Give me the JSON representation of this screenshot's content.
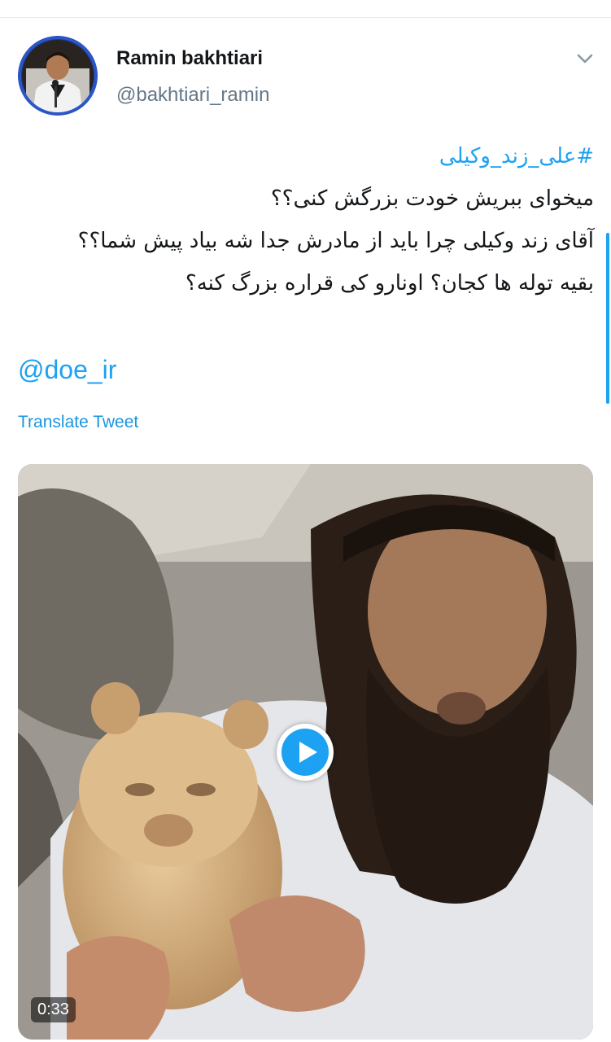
{
  "author": {
    "display_name": "Ramin bakhtiari",
    "username": "@bakhtiari_ramin",
    "avatar_icon": "user-avatar-photo"
  },
  "tweet": {
    "hashtag": "#علی_زند_وکیلی",
    "lines": [
      "میخوای ببریش خودت بزرگش کنی؟؟",
      "آقای زند وکیلی چرا باید از مادرش جدا شه بیاد پیش شما؟؟",
      "بقیه توله ها کجان؟ اونارو کی قراره بزرگ کنه؟"
    ],
    "mention": "@doe_ir",
    "translate_label": "Translate Tweet"
  },
  "media": {
    "type": "video",
    "duration": "0:33",
    "play_icon": "play-icon"
  },
  "colors": {
    "accent": "#1da1f2",
    "link": "#1b95e0",
    "secondary_text": "#657786",
    "divider": "#e6ecf0"
  }
}
